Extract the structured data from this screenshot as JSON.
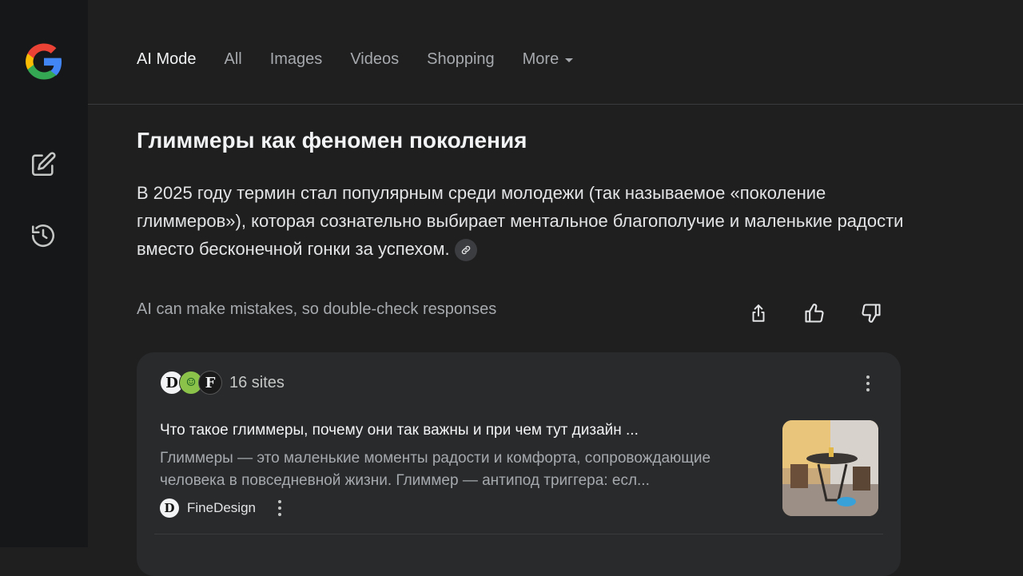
{
  "tabs": [
    {
      "label": "AI Mode",
      "active": true
    },
    {
      "label": "All",
      "active": false
    },
    {
      "label": "Images",
      "active": false
    },
    {
      "label": "Videos",
      "active": false
    },
    {
      "label": "Shopping",
      "active": false
    },
    {
      "label": "More",
      "active": false
    }
  ],
  "rail": {
    "logo_icon": "google-logo",
    "buttons": [
      "new-chat-icon",
      "history-icon"
    ]
  },
  "answer": {
    "heading": "Глиммеры как феномен поколения",
    "paragraph": "В 2025 году термин стал популярным среди молодежи (так называемое «поколение глиммеров»), которая сознательно выбирает ментальное благополучие и маленькие радости вместо бесконечной гонки за успехом.",
    "disclaimer": "AI can make mistakes, so double-check responses"
  },
  "sources": {
    "count_label": "16 sites",
    "items": [
      {
        "title": "Что такое глиммеры, почему они так важны и при чем тут дизайн ...",
        "snippet": "Глиммеры — это маленькие моменты радости и комфорта, сопровождающие человека в повседневной жизни. Глиммер — антипод триггера: есл...",
        "source_name": "FineDesign"
      }
    ]
  },
  "colors": {
    "background": "#1f1f1f",
    "rail": "#161718",
    "card": "#282a2c",
    "text_primary": "#f1f3f4",
    "text_secondary": "#a6a9ad"
  }
}
